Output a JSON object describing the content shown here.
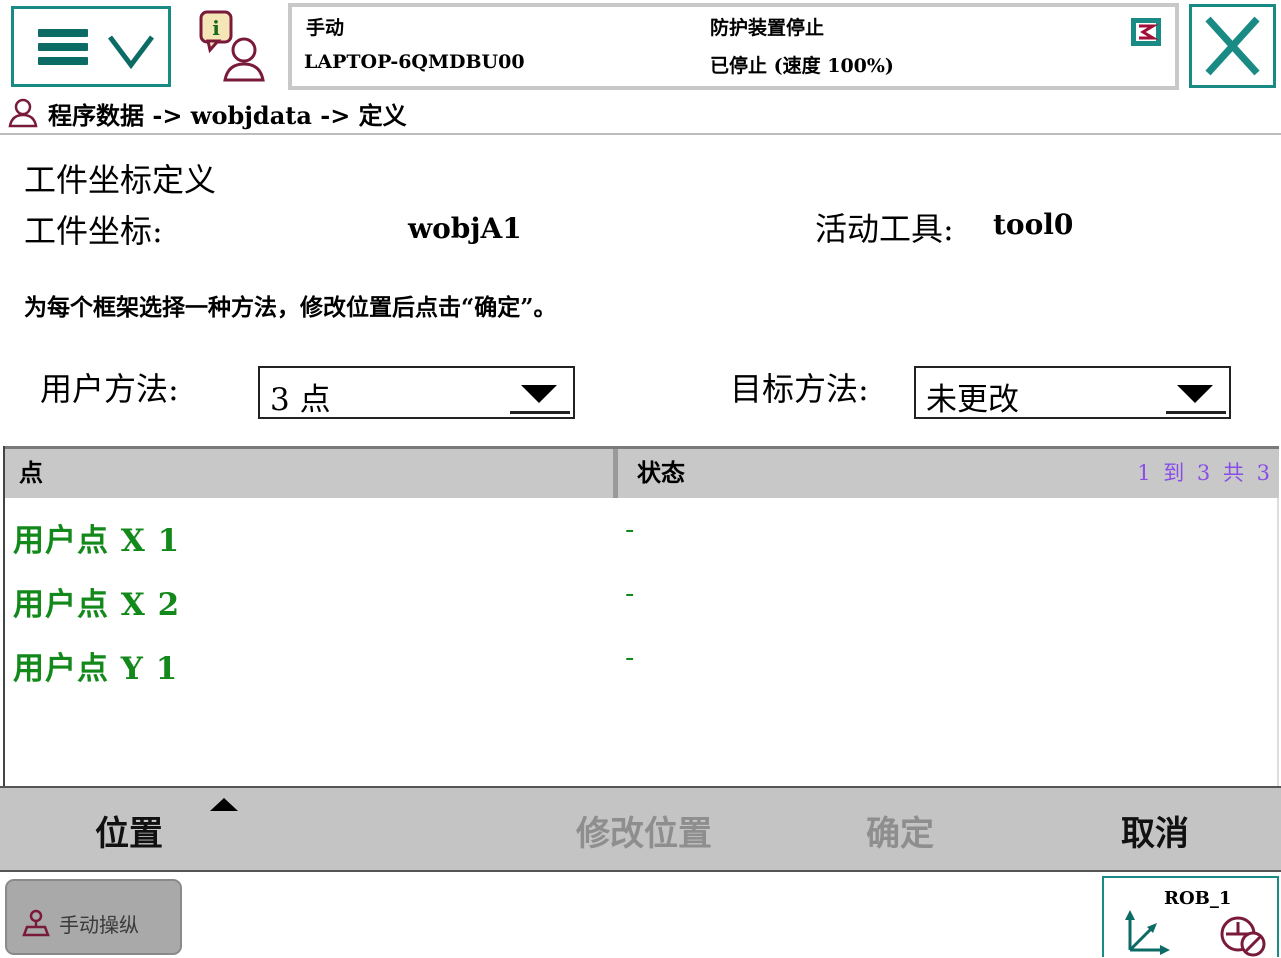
{
  "header": {
    "mode": "手动",
    "controller": "LAPTOP-6QMDBU00",
    "safety_state": "防护装置停止",
    "run_state": "已停止 (速度 100%)"
  },
  "breadcrumb": "程序数据 -> wobjdata -> 定义",
  "form": {
    "title": "工件坐标定义",
    "wobj_label": "工件坐标:",
    "wobj_value": "wobjA1",
    "tool_label": "活动工具:",
    "tool_value": "tool0",
    "instruction": "为每个框架选择一种方法，修改位置后点击“确定”。",
    "user_method_label": "用户方法:",
    "user_method_value": "3 点",
    "target_method_label": "目标方法:",
    "target_method_value": "未更改"
  },
  "table": {
    "columns": [
      "点",
      "状态"
    ],
    "range": "1 到 3 共 3",
    "rows": [
      {
        "name": "用户点 X 1",
        "status": "-"
      },
      {
        "name": "用户点 X 2",
        "status": "-"
      },
      {
        "name": "用户点 Y 1",
        "status": "-"
      }
    ]
  },
  "commands": {
    "position": "位置",
    "modify_position": "修改位置",
    "ok": "确定",
    "cancel": "取消"
  },
  "taskbar": {
    "jog": "手动操纵",
    "robot": "ROB_1"
  },
  "colors": {
    "accent": "#1a8a84",
    "row_text": "#12891a",
    "range_text": "#8a4de8",
    "disabled": "#8e8e8e"
  },
  "icons": [
    "menu-icon",
    "event-log-icon",
    "close-icon",
    "user-icon",
    "jog-icon",
    "coordinate-axes-icon",
    "robot-stopped-icon"
  ]
}
